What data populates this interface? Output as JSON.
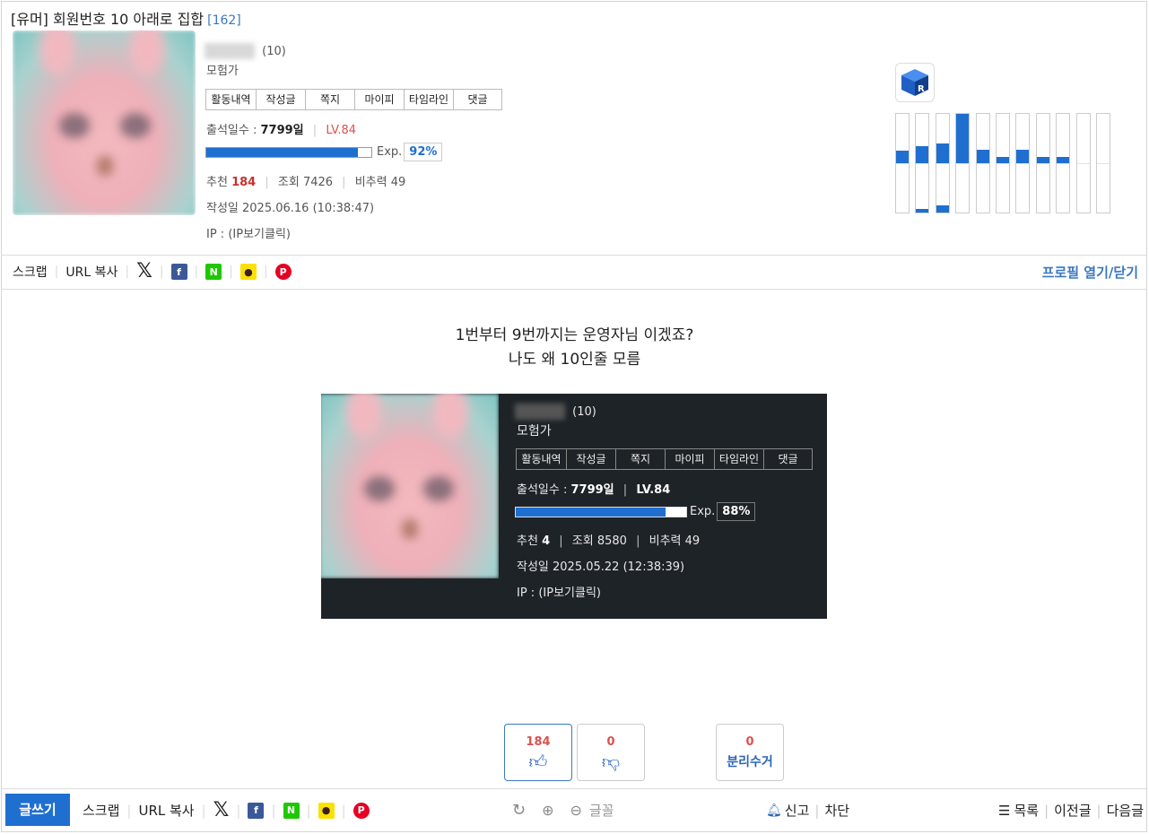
{
  "post": {
    "title": "[유머] 회원번호 10 아래로 집합",
    "comment_count": "[162]"
  },
  "author": {
    "member_no": "(10)",
    "rank": "모험가",
    "buttons": [
      "활동내역",
      "작성글",
      "쪽지",
      "마이피",
      "타임라인",
      "댓글"
    ],
    "attendance_label": "출석일수 :",
    "attendance_value": "7799일",
    "level": "LV.84",
    "exp_label": "Exp.",
    "exp_pct": "92%",
    "exp_fraction": 0.92,
    "recommend_label": "추천",
    "recommend_value": "184",
    "views_label": "조회",
    "views_value": "7426",
    "ratio_label": "비추력",
    "ratio_value": "49",
    "date": "작성일 2025.06.16 (10:38:47)",
    "ip": "IP : (IP보기클릭)"
  },
  "activity_graph": {
    "upper_values": [
      0.25,
      0.35,
      0.4,
      1.0,
      0.28,
      0.12,
      0.28,
      0.12,
      0.12,
      0,
      0
    ],
    "lower_values": [
      0,
      0.08,
      0.14,
      0,
      0,
      0,
      0,
      0,
      0,
      0,
      0
    ]
  },
  "share": {
    "scrap": "스크랩",
    "url_copy": "URL 복사",
    "profile_toggle": "프로필 열기/닫기"
  },
  "content": {
    "line1": "1번부터 9번까지는 운영자님 이겠죠?",
    "line2": "나도 왜 10인줄 모름"
  },
  "embedded": {
    "member_no": "(10)",
    "rank": "모험가",
    "buttons": [
      "활동내역",
      "작성글",
      "쪽지",
      "마이피",
      "타임라인",
      "댓글"
    ],
    "attendance_label": "출석일수 :",
    "attendance_value": "7799일",
    "level": "LV.84",
    "exp_label": "Exp.",
    "exp_pct": "88%",
    "exp_fraction": 0.88,
    "recommend_label": "추천",
    "recommend_value": "4",
    "views_label": "조회",
    "views_value": "8580",
    "ratio_label": "비추력",
    "ratio_value": "49",
    "date": "작성일 2025.05.22 (12:38:39)",
    "ip": "IP : (IP보기클릭)"
  },
  "votes": {
    "up": "184",
    "down": "0",
    "dispose_count": "0",
    "dispose_label": "분리수거"
  },
  "bottom": {
    "write": "글쓰기",
    "scrap": "스크랩",
    "url_copy": "URL 복사",
    "font": "글꼴",
    "report": "신고",
    "block": "차단",
    "list": "목록",
    "prev": "이전글",
    "next": "다음글"
  },
  "colors": {
    "accent": "#1f6fd1",
    "link": "#3a78c2",
    "level": "#d9534f",
    "recommend": "#c9302c"
  }
}
